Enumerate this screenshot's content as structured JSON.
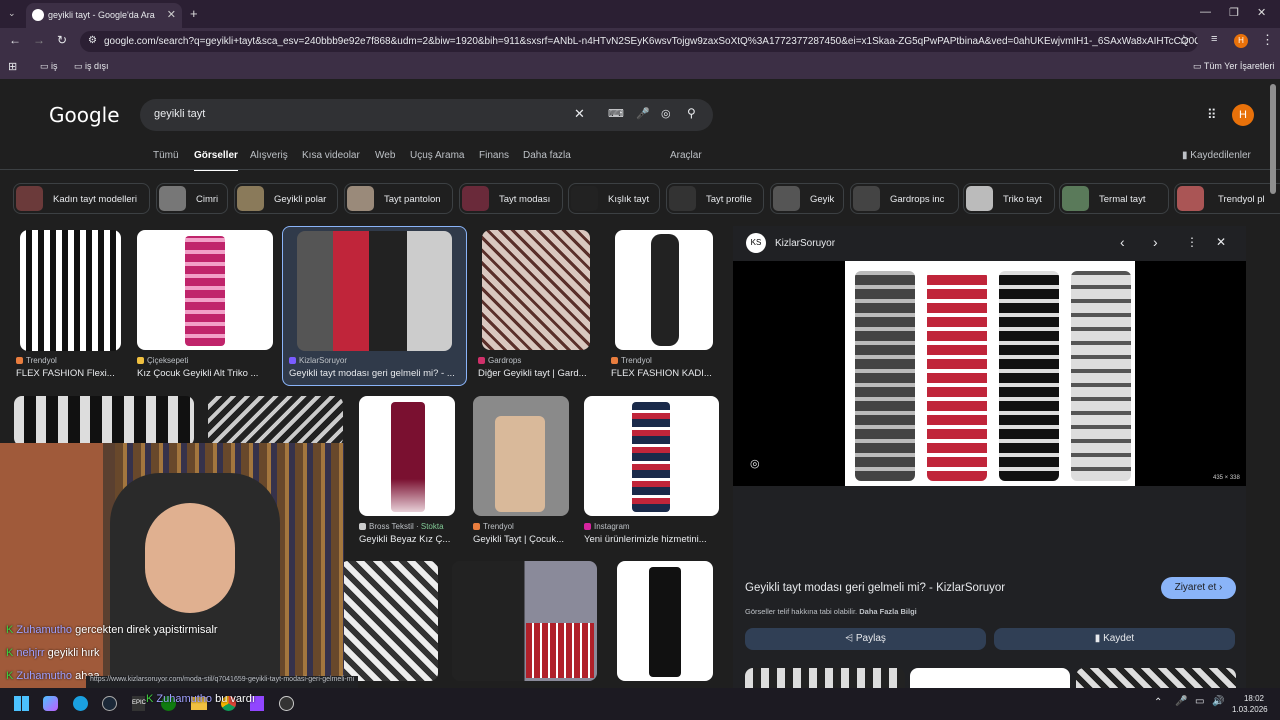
{
  "browser": {
    "tab_title": "geyikli tayt - Google'da Ara",
    "url": "google.com/search?q=geyikli+tayt&sca_esv=240bbb9e92e7f868&udm=2&biw=1920&bih=911&sxsrf=ANbL-n4HTvN2SEyK6wsvTojgw9zaxSoXtQ%3A1772377287450&ei=x1Skaa-ZG5qPwPAPtbinaA&ved=0ahUKEwjvmIH1-_6SAxWa8xAIHTcCQ0Q4dUDCBE...",
    "bookmarks": [
      "iş",
      "iş dışı"
    ],
    "all_bookmarks": "Tüm Yer İşaretleri",
    "profile_initial": "H"
  },
  "google": {
    "logo": "Google",
    "query": "geyikli tayt",
    "tabs": [
      "Tümü",
      "Görseller",
      "Alışveriş",
      "Kısa videolar",
      "Web",
      "Uçuş Arama",
      "Finans",
      "Daha fazla"
    ],
    "tools": "Araçlar",
    "saved": "Kaydedilenler",
    "chips": [
      "Kadın tayt modelleri",
      "Cimri",
      "Geyikli polar",
      "Tayt pantolon",
      "Tayt modası",
      "Kışlık tayt",
      "Tayt profile",
      "Geyik",
      "Gardrops inc",
      "Triko tayt",
      "Termal tayt",
      "Trendyol pl"
    ],
    "results": [
      {
        "source": "Trendyol",
        "caption": "FLEX FASHION Flexi..."
      },
      {
        "source": "Çiçeksepeti",
        "caption": "Kız Çocuk Geyikli Alt Triko ..."
      },
      {
        "source": "KizlarSoruyor",
        "caption": "Geyikli tayt modası geri gelmeli mi? - ..."
      },
      {
        "source": "Gardrops",
        "caption": "Diğer Geyikli tayt | Gard..."
      },
      {
        "source": "Trendyol",
        "caption": "FLEX FASHION KADI..."
      },
      {
        "source": "Bross Tekstil",
        "stock": "Stokta",
        "caption": "Geyikli Beyaz Kız Ç..."
      },
      {
        "source": "Trendyol",
        "caption": "Geyikli Tayt | Çocuk..."
      },
      {
        "source": "Instagram",
        "caption": "Yeni ürünlerimizle hizmetini..."
      }
    ]
  },
  "panel": {
    "site": "KizlarSoruyor",
    "image_size": "435 × 338",
    "title": "Geyikli tayt modası geri gelmeli mi? - KizlarSoruyor",
    "visit": "Ziyaret et",
    "copyright": "Görseller telif hakkına tabi olabilir.",
    "more_info": "Daha Fazla Bilgi",
    "share": "Paylaş",
    "save": "Kaydet"
  },
  "overlay": {
    "chat": [
      {
        "user": "Zuhamutho",
        "text": "gercekten direk yapistirmisalr"
      },
      {
        "user": "nehjrr",
        "text": "geyikli hırk"
      },
      {
        "user": "Zuhamutho",
        "text": "ahaa"
      },
      {
        "user": "Zuhamutho",
        "text": "bu vardı"
      }
    ],
    "status_url": "https://www.kizlarsoruyor.com/moda-stil/q7041659-geyikli-tayt-modasi-geri-gelmeli-mi"
  },
  "taskbar": {
    "time": "18:02",
    "date": "1.03.2026"
  }
}
